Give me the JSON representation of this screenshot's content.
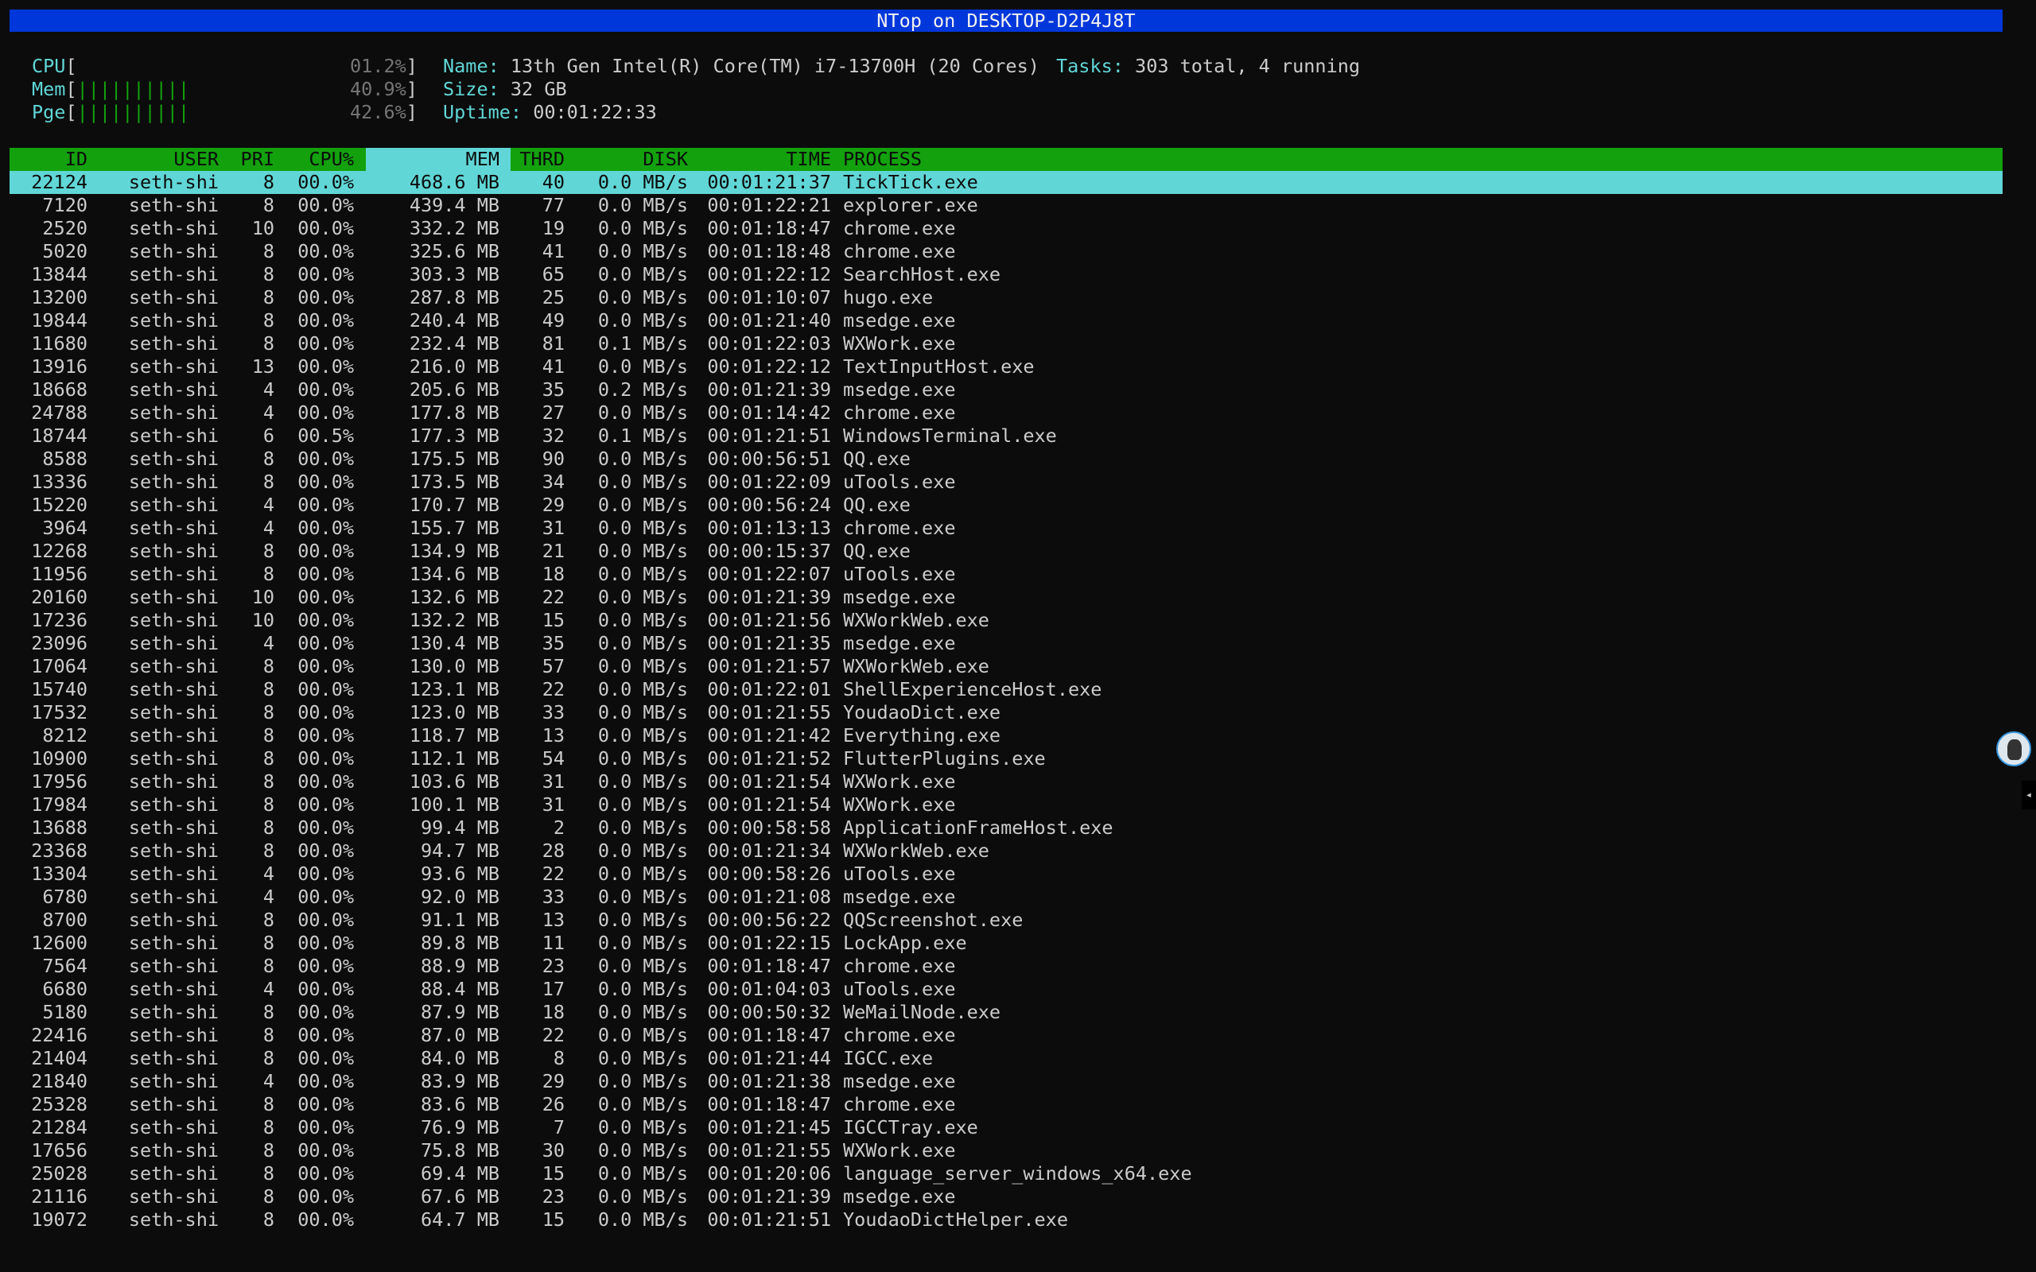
{
  "window": {
    "title": "NTop on DESKTOP-D2P4J8T"
  },
  "meters": [
    {
      "label": "CPU",
      "bars": "",
      "value": "01.2%"
    },
    {
      "label": "Mem",
      "bars": "||||||||||",
      "value": "40.9%"
    },
    {
      "label": "Pge",
      "bars": "||||||||||",
      "value": "42.6%"
    }
  ],
  "info": {
    "name_label": "Name:",
    "name": "13th Gen Intel(R) Core(TM) i7-13700H (20 Cores)",
    "tasks_label": "Tasks:",
    "tasks": "303 total, 4 running",
    "size_label": "Size:",
    "size": "32 GB",
    "uptime_label": "Uptime:",
    "uptime": "00:01:22:33"
  },
  "columns": {
    "id": "ID",
    "user": "USER",
    "pri": "PRI",
    "cpu": "CPU%",
    "mem": "MEM",
    "thrd": "THRD",
    "disk": "DISK",
    "time": "TIME",
    "proc": "PROCESS"
  },
  "processes": [
    [
      "22124",
      "seth-shi",
      "8",
      "00.0%",
      "468.6 MB",
      "40",
      "0.0 MB/s",
      "00:01:21:37",
      "TickTick.exe"
    ],
    [
      "7120",
      "seth-shi",
      "8",
      "00.0%",
      "439.4 MB",
      "77",
      "0.0 MB/s",
      "00:01:22:21",
      "explorer.exe"
    ],
    [
      "2520",
      "seth-shi",
      "10",
      "00.0%",
      "332.2 MB",
      "19",
      "0.0 MB/s",
      "00:01:18:47",
      "chrome.exe"
    ],
    [
      "5020",
      "seth-shi",
      "8",
      "00.0%",
      "325.6 MB",
      "41",
      "0.0 MB/s",
      "00:01:18:48",
      "chrome.exe"
    ],
    [
      "13844",
      "seth-shi",
      "8",
      "00.0%",
      "303.3 MB",
      "65",
      "0.0 MB/s",
      "00:01:22:12",
      "SearchHost.exe"
    ],
    [
      "13200",
      "seth-shi",
      "8",
      "00.0%",
      "287.8 MB",
      "25",
      "0.0 MB/s",
      "00:01:10:07",
      "hugo.exe"
    ],
    [
      "19844",
      "seth-shi",
      "8",
      "00.0%",
      "240.4 MB",
      "49",
      "0.0 MB/s",
      "00:01:21:40",
      "msedge.exe"
    ],
    [
      "11680",
      "seth-shi",
      "8",
      "00.0%",
      "232.4 MB",
      "81",
      "0.1 MB/s",
      "00:01:22:03",
      "WXWork.exe"
    ],
    [
      "13916",
      "seth-shi",
      "13",
      "00.0%",
      "216.0 MB",
      "41",
      "0.0 MB/s",
      "00:01:22:12",
      "TextInputHost.exe"
    ],
    [
      "18668",
      "seth-shi",
      "4",
      "00.0%",
      "205.6 MB",
      "35",
      "0.2 MB/s",
      "00:01:21:39",
      "msedge.exe"
    ],
    [
      "24788",
      "seth-shi",
      "4",
      "00.0%",
      "177.8 MB",
      "27",
      "0.0 MB/s",
      "00:01:14:42",
      "chrome.exe"
    ],
    [
      "18744",
      "seth-shi",
      "6",
      "00.5%",
      "177.3 MB",
      "32",
      "0.1 MB/s",
      "00:01:21:51",
      "WindowsTerminal.exe"
    ],
    [
      "8588",
      "seth-shi",
      "8",
      "00.0%",
      "175.5 MB",
      "90",
      "0.0 MB/s",
      "00:00:56:51",
      "QQ.exe"
    ],
    [
      "13336",
      "seth-shi",
      "8",
      "00.0%",
      "173.5 MB",
      "34",
      "0.0 MB/s",
      "00:01:22:09",
      "uTools.exe"
    ],
    [
      "15220",
      "seth-shi",
      "4",
      "00.0%",
      "170.7 MB",
      "29",
      "0.0 MB/s",
      "00:00:56:24",
      "QQ.exe"
    ],
    [
      "3964",
      "seth-shi",
      "4",
      "00.0%",
      "155.7 MB",
      "31",
      "0.0 MB/s",
      "00:01:13:13",
      "chrome.exe"
    ],
    [
      "12268",
      "seth-shi",
      "8",
      "00.0%",
      "134.9 MB",
      "21",
      "0.0 MB/s",
      "00:00:15:37",
      "QQ.exe"
    ],
    [
      "11956",
      "seth-shi",
      "8",
      "00.0%",
      "134.6 MB",
      "18",
      "0.0 MB/s",
      "00:01:22:07",
      "uTools.exe"
    ],
    [
      "20160",
      "seth-shi",
      "10",
      "00.0%",
      "132.6 MB",
      "22",
      "0.0 MB/s",
      "00:01:21:39",
      "msedge.exe"
    ],
    [
      "17236",
      "seth-shi",
      "10",
      "00.0%",
      "132.2 MB",
      "15",
      "0.0 MB/s",
      "00:01:21:56",
      "WXWorkWeb.exe"
    ],
    [
      "23096",
      "seth-shi",
      "4",
      "00.0%",
      "130.4 MB",
      "35",
      "0.0 MB/s",
      "00:01:21:35",
      "msedge.exe"
    ],
    [
      "17064",
      "seth-shi",
      "8",
      "00.0%",
      "130.0 MB",
      "57",
      "0.0 MB/s",
      "00:01:21:57",
      "WXWorkWeb.exe"
    ],
    [
      "15740",
      "seth-shi",
      "8",
      "00.0%",
      "123.1 MB",
      "22",
      "0.0 MB/s",
      "00:01:22:01",
      "ShellExperienceHost.exe"
    ],
    [
      "17532",
      "seth-shi",
      "8",
      "00.0%",
      "123.0 MB",
      "33",
      "0.0 MB/s",
      "00:01:21:55",
      "YoudaoDict.exe"
    ],
    [
      "8212",
      "seth-shi",
      "8",
      "00.0%",
      "118.7 MB",
      "13",
      "0.0 MB/s",
      "00:01:21:42",
      "Everything.exe"
    ],
    [
      "10900",
      "seth-shi",
      "8",
      "00.0%",
      "112.1 MB",
      "54",
      "0.0 MB/s",
      "00:01:21:52",
      "FlutterPlugins.exe"
    ],
    [
      "17956",
      "seth-shi",
      "8",
      "00.0%",
      "103.6 MB",
      "31",
      "0.0 MB/s",
      "00:01:21:54",
      "WXWork.exe"
    ],
    [
      "17984",
      "seth-shi",
      "8",
      "00.0%",
      "100.1 MB",
      "31",
      "0.0 MB/s",
      "00:01:21:54",
      "WXWork.exe"
    ],
    [
      "13688",
      "seth-shi",
      "8",
      "00.0%",
      "99.4 MB",
      "2",
      "0.0 MB/s",
      "00:00:58:58",
      "ApplicationFrameHost.exe"
    ],
    [
      "23368",
      "seth-shi",
      "8",
      "00.0%",
      "94.7 MB",
      "28",
      "0.0 MB/s",
      "00:01:21:34",
      "WXWorkWeb.exe"
    ],
    [
      "13304",
      "seth-shi",
      "4",
      "00.0%",
      "93.6 MB",
      "22",
      "0.0 MB/s",
      "00:00:58:26",
      "uTools.exe"
    ],
    [
      "6780",
      "seth-shi",
      "4",
      "00.0%",
      "92.0 MB",
      "33",
      "0.0 MB/s",
      "00:01:21:08",
      "msedge.exe"
    ],
    [
      "8700",
      "seth-shi",
      "8",
      "00.0%",
      "91.1 MB",
      "13",
      "0.0 MB/s",
      "00:00:56:22",
      "QQScreenshot.exe"
    ],
    [
      "12600",
      "seth-shi",
      "8",
      "00.0%",
      "89.8 MB",
      "11",
      "0.0 MB/s",
      "00:01:22:15",
      "LockApp.exe"
    ],
    [
      "7564",
      "seth-shi",
      "8",
      "00.0%",
      "88.9 MB",
      "23",
      "0.0 MB/s",
      "00:01:18:47",
      "chrome.exe"
    ],
    [
      "6680",
      "seth-shi",
      "4",
      "00.0%",
      "88.4 MB",
      "17",
      "0.0 MB/s",
      "00:01:04:03",
      "uTools.exe"
    ],
    [
      "5180",
      "seth-shi",
      "8",
      "00.0%",
      "87.9 MB",
      "18",
      "0.0 MB/s",
      "00:00:50:32",
      "WeMailNode.exe"
    ],
    [
      "22416",
      "seth-shi",
      "8",
      "00.0%",
      "87.0 MB",
      "22",
      "0.0 MB/s",
      "00:01:18:47",
      "chrome.exe"
    ],
    [
      "21404",
      "seth-shi",
      "8",
      "00.0%",
      "84.0 MB",
      "8",
      "0.0 MB/s",
      "00:01:21:44",
      "IGCC.exe"
    ],
    [
      "21840",
      "seth-shi",
      "4",
      "00.0%",
      "83.9 MB",
      "29",
      "0.0 MB/s",
      "00:01:21:38",
      "msedge.exe"
    ],
    [
      "25328",
      "seth-shi",
      "8",
      "00.0%",
      "83.6 MB",
      "26",
      "0.0 MB/s",
      "00:01:18:47",
      "chrome.exe"
    ],
    [
      "21284",
      "seth-shi",
      "8",
      "00.0%",
      "76.9 MB",
      "7",
      "0.0 MB/s",
      "00:01:21:45",
      "IGCCTray.exe"
    ],
    [
      "17656",
      "seth-shi",
      "8",
      "00.0%",
      "75.8 MB",
      "30",
      "0.0 MB/s",
      "00:01:21:55",
      "WXWork.exe"
    ],
    [
      "25028",
      "seth-shi",
      "8",
      "00.0%",
      "69.4 MB",
      "15",
      "0.0 MB/s",
      "00:01:20:06",
      "language_server_windows_x64.exe"
    ],
    [
      "21116",
      "seth-shi",
      "8",
      "00.0%",
      "67.6 MB",
      "23",
      "0.0 MB/s",
      "00:01:21:39",
      "msedge.exe"
    ],
    [
      "19072",
      "seth-shi",
      "8",
      "00.0%",
      "64.7 MB",
      "15",
      "0.0 MB/s",
      "00:01:21:51",
      "YoudaoDictHelper.exe"
    ]
  ],
  "colors": {
    "title_bg": "#0037da",
    "header_bg": "#13a10e",
    "selected_bg": "#61d6d6",
    "label": "#3a96dd",
    "meter_bar": "#13a10e"
  }
}
